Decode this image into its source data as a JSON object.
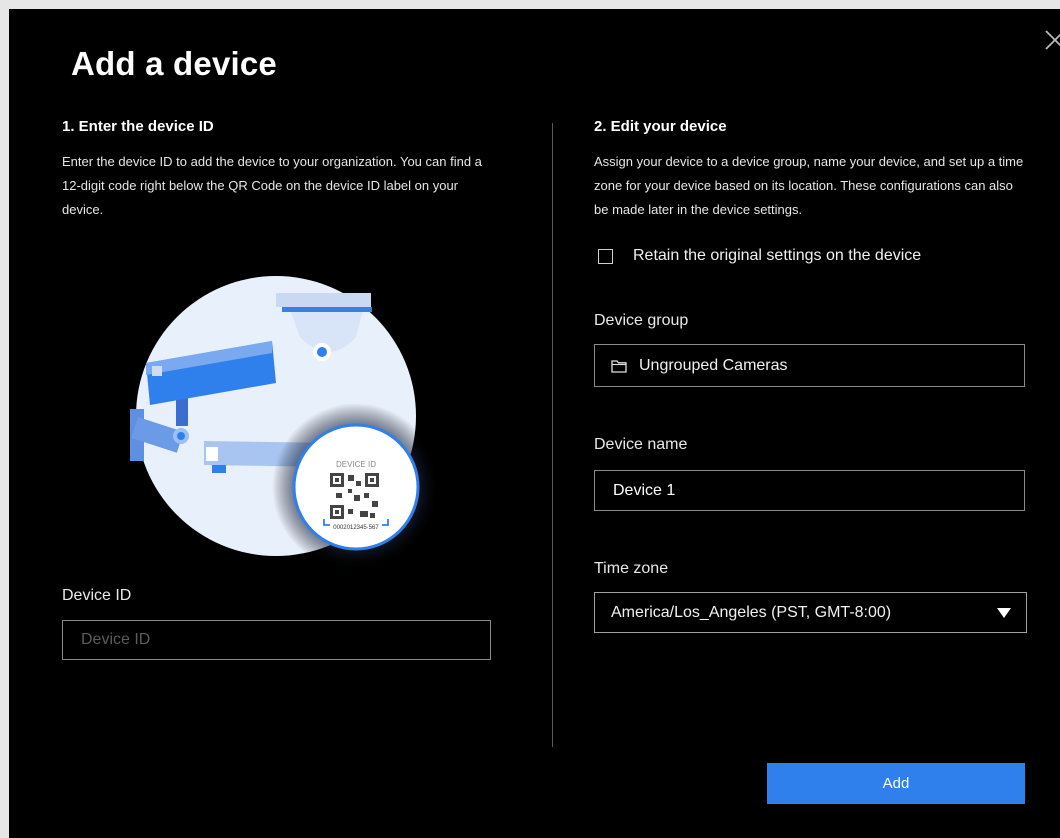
{
  "dialog": {
    "title": "Add a device",
    "close_icon": "close-icon"
  },
  "step1": {
    "title": "1. Enter the device ID",
    "description": "Enter the device ID to add the device to your organization. You can find a 12-digit code right below the QR Code on the device ID label on your device.",
    "illustration": {
      "qr_label": "DEVICE ID",
      "qr_code_number": "0002012345·567"
    },
    "device_id_label": "Device ID",
    "device_id_placeholder": "Device ID",
    "device_id_value": ""
  },
  "step2": {
    "title": "2. Edit your device",
    "description": "Assign your device to a device group, name your device, and set up a time zone for your device based on its location. These configurations can also be made later in the device settings.",
    "retain_label": "Retain the original settings on the device",
    "retain_checked": false,
    "device_group_label": "Device group",
    "device_group_value": "Ungrouped Cameras",
    "device_group_icon": "folder-icon",
    "device_name_label": "Device name",
    "device_name_value": "Device 1",
    "time_zone_label": "Time zone",
    "time_zone_value": "America/Los_Angeles (PST, GMT-8:00)",
    "time_zone_icon": "caret-down-icon"
  },
  "footer": {
    "add_label": "Add"
  },
  "colors": {
    "background": "#000000",
    "accent": "#2f80ed",
    "border": "#8a8a8a",
    "illustration_circle": "#e8f0fb"
  }
}
